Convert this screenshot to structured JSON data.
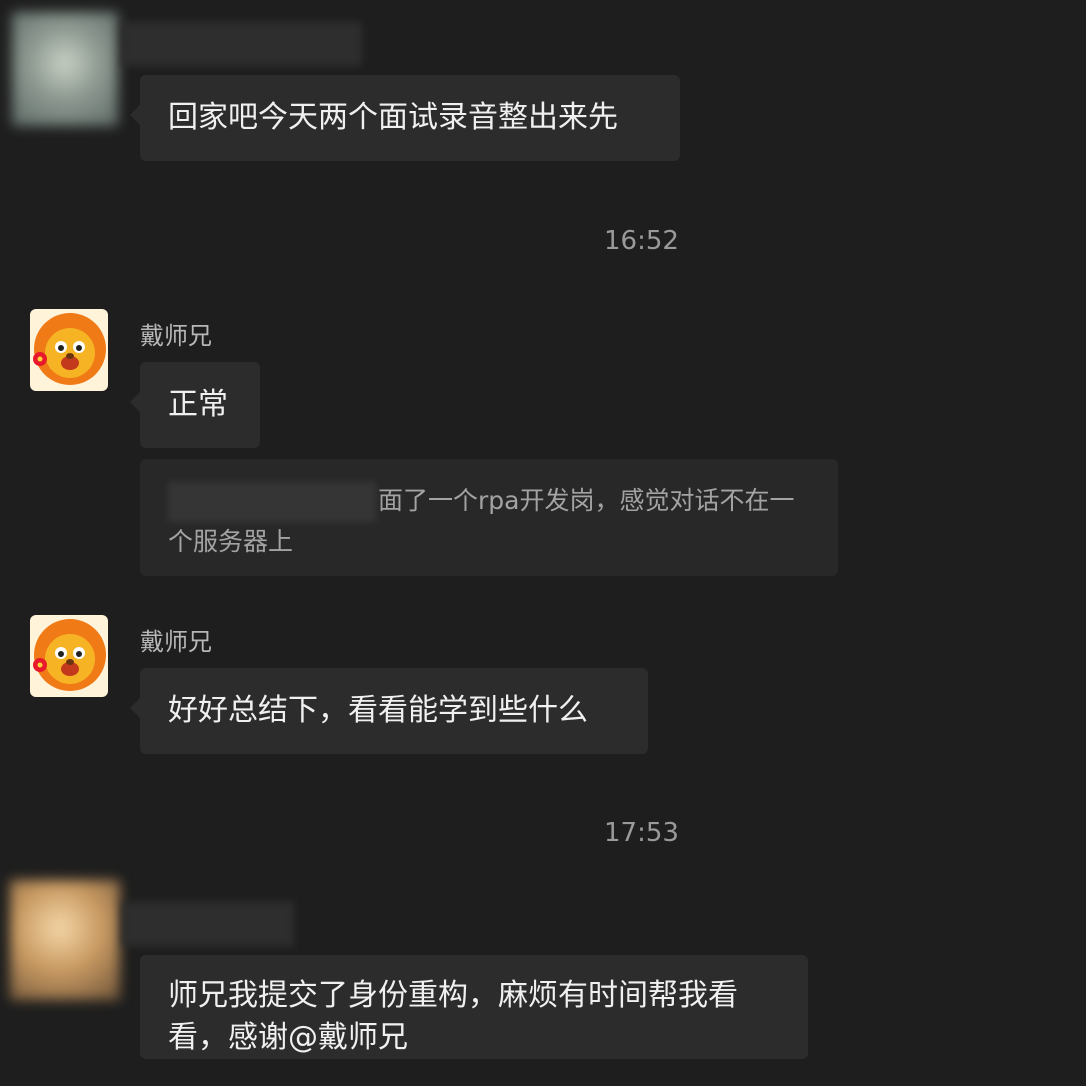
{
  "messages": [
    {
      "type": "incoming",
      "sender": "",
      "text": "回家吧今天两个面试录音整出来先"
    },
    {
      "type": "timestamp",
      "text": "16:52"
    },
    {
      "type": "incoming",
      "sender": "戴师兄",
      "text": "正常"
    },
    {
      "type": "quote",
      "text": "面了一个rpa开发岗，感觉对话不在一个服务器上"
    },
    {
      "type": "incoming",
      "sender": "戴师兄",
      "text": "好好总结下，看看能学到些什么"
    },
    {
      "type": "timestamp",
      "text": "17:53"
    },
    {
      "type": "incoming",
      "sender": "",
      "text": "师兄我提交了身份重构，麻烦有时间帮我看看，感谢@戴师兄"
    }
  ],
  "avatars": {
    "lion_avatar_icon": "lion-cartoon-icon",
    "lion_colors": {
      "mane": "#f07a16",
      "face": "#f6b425",
      "bg": "#fff3da",
      "flower": "#e8192c"
    }
  }
}
